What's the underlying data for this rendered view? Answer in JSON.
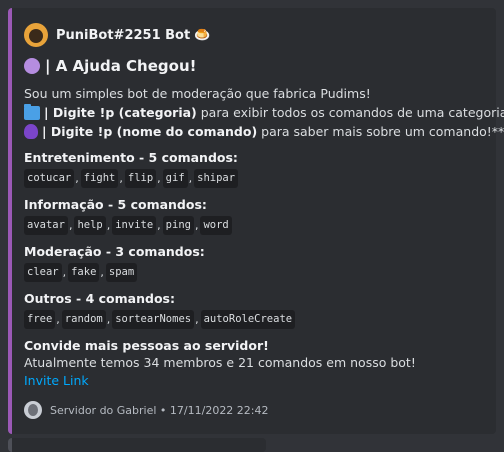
{
  "author": {
    "name": "PuniBot#2251 Bot",
    "emoji": "🍮"
  },
  "title": "| A Ajuda Chegou!",
  "description": {
    "intro": "Sou um simples bot de moderação que fabrica Pudims!",
    "line2_bold": "| Digite !p (categoria)",
    "line2_rest": " para exibir todos os comandos de uma categoria ou",
    "line3_bold": "| Digite !p (nome do comando)",
    "line3_rest": " para saber mais sobre um comando!**"
  },
  "fields": [
    {
      "name": "Entretenimento - 5 comandos:",
      "commands": [
        "cotucar",
        "fight",
        "flip",
        "gif",
        "shipar"
      ]
    },
    {
      "name": "Informação - 5 comandos:",
      "commands": [
        "avatar",
        "help",
        "invite",
        "ping",
        "word"
      ]
    },
    {
      "name": "Moderação - 3 comandos:",
      "commands": [
        "clear",
        "fake",
        "spam"
      ]
    },
    {
      "name": "Outros - 4 comandos:",
      "commands": [
        "free",
        "random",
        "sortearNomes",
        "autoRoleCreate"
      ]
    }
  ],
  "invite": {
    "heading": "Convide mais pessoas ao servidor!",
    "text": "Atualmente temos 34 membros e 21 comandos em nosso bot!",
    "link": "Invite Link"
  },
  "footer": {
    "text": "Servidor do Gabriel • 17/11/2022 22:42"
  },
  "colors": {
    "embed_accent": "#9b59b6",
    "link": "#00a8fc",
    "background": "#313338",
    "embed_bg": "#2b2d31"
  },
  "icons": {
    "title": "purple-circle-icon",
    "line2": "folder-icon",
    "line3": "alien-monster-icon"
  }
}
